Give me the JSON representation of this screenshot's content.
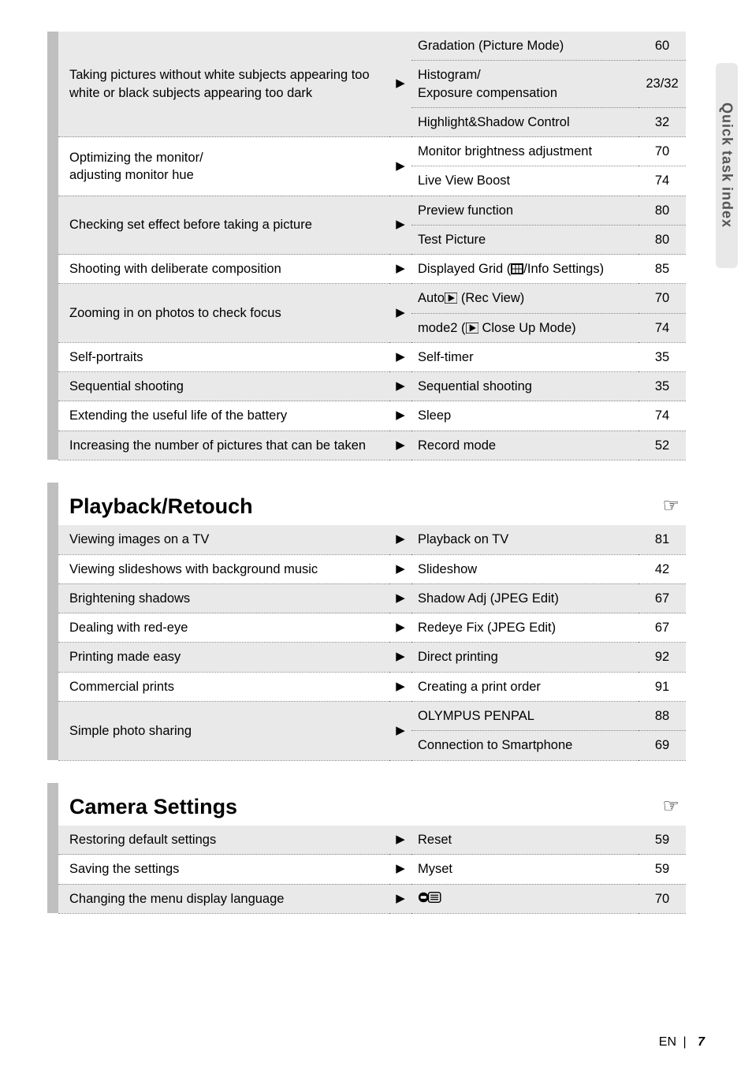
{
  "sideTab": "Quick task index",
  "footer": {
    "lang": "EN",
    "page": "7"
  },
  "handIcon": "☞",
  "section1": {
    "rows": [
      {
        "topic": "Taking pictures without white subjects appearing too white or black subjects appearing too dark",
        "sub": [
          {
            "target": "Gradation (Picture Mode)",
            "page": "60"
          },
          {
            "target": "Histogram/\nExposure compensation",
            "page": "23/32"
          },
          {
            "target": "Highlight&Shadow Control",
            "page": "32"
          }
        ]
      },
      {
        "topic": "Optimizing the monitor/\nadjusting monitor hue",
        "sub": [
          {
            "target": "Monitor brightness adjustment",
            "page": "70"
          },
          {
            "target": "Live View Boost",
            "page": "74"
          }
        ]
      },
      {
        "topic": "Checking set effect before taking a picture",
        "sub": [
          {
            "target": "Preview function",
            "page": "80"
          },
          {
            "target": "Test Picture",
            "page": "80"
          }
        ]
      },
      {
        "topic": "Shooting with deliberate composition",
        "sub": [
          {
            "target": "Displayed Grid (▦/Info Settings)",
            "page": "85"
          }
        ]
      },
      {
        "topic": "Zooming in on photos to check focus",
        "sub": [
          {
            "target": "Auto▶ (Rec View)",
            "page": "70"
          },
          {
            "target": "mode2 (▶ Close Up Mode)",
            "page": "74"
          }
        ]
      },
      {
        "topic": "Self-portraits",
        "sub": [
          {
            "target": "Self-timer",
            "page": "35"
          }
        ]
      },
      {
        "topic": "Sequential shooting",
        "sub": [
          {
            "target": "Sequential shooting",
            "page": "35"
          }
        ]
      },
      {
        "topic": "Extending the useful life of the battery",
        "sub": [
          {
            "target": "Sleep",
            "page": "74"
          }
        ]
      },
      {
        "topic": "Increasing the number of pictures that can be taken",
        "sub": [
          {
            "target": "Record mode",
            "page": "52"
          }
        ]
      }
    ]
  },
  "section2": {
    "title": "Playback/Retouch",
    "rows": [
      {
        "topic": "Viewing images on a TV",
        "sub": [
          {
            "target": "Playback on TV",
            "page": "81"
          }
        ]
      },
      {
        "topic": "Viewing slideshows with background music",
        "sub": [
          {
            "target": "Slideshow",
            "page": "42"
          }
        ]
      },
      {
        "topic": "Brightening shadows",
        "sub": [
          {
            "target": "Shadow Adj (JPEG Edit)",
            "page": "67"
          }
        ]
      },
      {
        "topic": "Dealing with red-eye",
        "sub": [
          {
            "target": "Redeye Fix (JPEG Edit)",
            "page": "67"
          }
        ]
      },
      {
        "topic": "Printing made easy",
        "sub": [
          {
            "target": "Direct printing",
            "page": "92"
          }
        ]
      },
      {
        "topic": "Commercial prints",
        "sub": [
          {
            "target": "Creating a print order",
            "page": "91"
          }
        ]
      },
      {
        "topic": "Simple photo sharing",
        "sub": [
          {
            "target": "OLYMPUS PENPAL",
            "page": "88"
          },
          {
            "target": "Connection to Smartphone",
            "page": "69"
          }
        ]
      }
    ]
  },
  "section3": {
    "title": "Camera Settings",
    "rows": [
      {
        "topic": "Restoring default settings",
        "sub": [
          {
            "target": "Reset",
            "page": "59"
          }
        ]
      },
      {
        "topic": "Saving the settings",
        "sub": [
          {
            "target": "Myset",
            "page": "59"
          }
        ]
      },
      {
        "topic": "Changing the menu display language",
        "sub": [
          {
            "target_icon": "lang-icon",
            "page": "70"
          }
        ]
      }
    ]
  }
}
